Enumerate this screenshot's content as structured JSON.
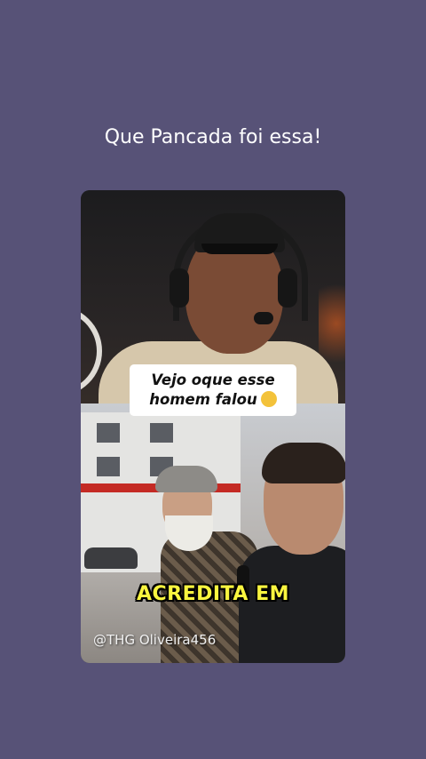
{
  "post": {
    "title": "Que Pancada foi essa!"
  },
  "video": {
    "caption_line1": "Vejo oque esse",
    "caption_line2": "homem falou",
    "caption_emoji": "face-screaming-in-fear-icon",
    "subtitle": "ACREDITA EM",
    "watermark": "@THG Oliveira456"
  },
  "colors": {
    "background": "#575277",
    "subtitle": "#f9f53f"
  }
}
